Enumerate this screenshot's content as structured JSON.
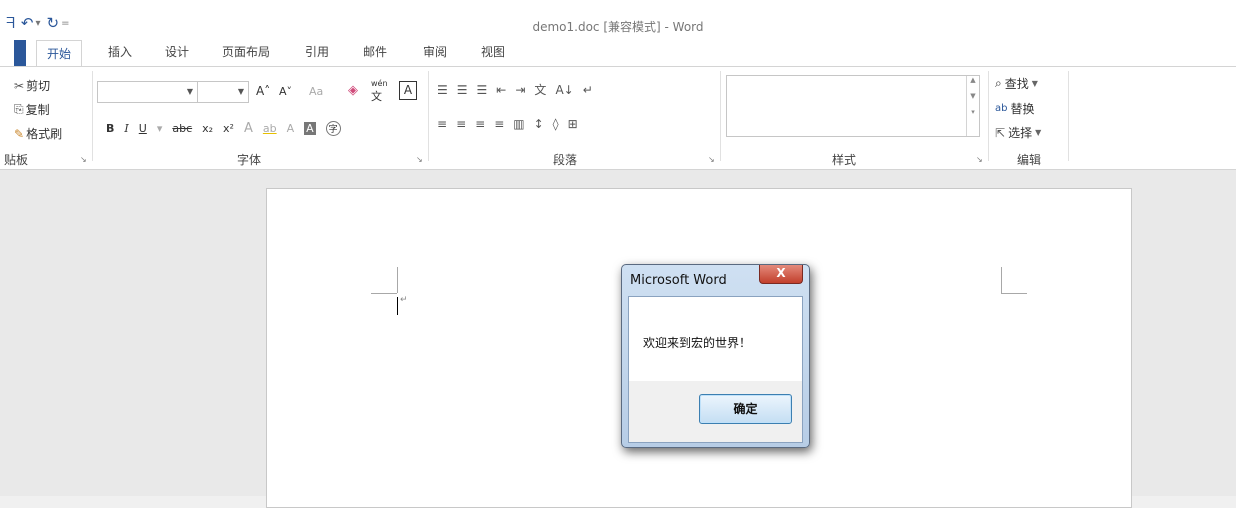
{
  "window": {
    "title": "demo1.doc [兼容模式] - Word"
  },
  "qat": {
    "save_glyph": "ᖷ",
    "undo_glyph": "↶",
    "redo_glyph": "↻",
    "dropdown_glyph": "▾",
    "customize_glyph": "="
  },
  "tabs": [
    {
      "label": "开始",
      "active": true
    },
    {
      "label": "插入"
    },
    {
      "label": "设计"
    },
    {
      "label": "页面布局"
    },
    {
      "label": "引用"
    },
    {
      "label": "邮件"
    },
    {
      "label": "审阅"
    },
    {
      "label": "视图"
    }
  ],
  "clipboard": {
    "cut": "剪切",
    "copy": "复制",
    "format_painter": "格式刷",
    "label": "贴板"
  },
  "font": {
    "label": "字体",
    "grow_glyph": "A˄",
    "shrink_glyph": "A˅",
    "case_glyph": "Aa",
    "clear_glyph": "◈",
    "pinyin_glyph": "wén",
    "pinyin_char": "文",
    "border_glyph": "A",
    "bold": "B",
    "italic": "I",
    "underline": "U",
    "strike": "abc",
    "sub": "x₂",
    "sup": "x²",
    "effects_glyph": "A",
    "highlight_glyph": "ab",
    "color_glyph": "A",
    "shade_glyph": "A",
    "enclose_glyph": "字"
  },
  "paragraph": {
    "label": "段落",
    "row1": [
      "☰",
      "☰",
      "☰",
      "⇤",
      "⇥",
      "文",
      "A↓",
      "↵"
    ],
    "row2": [
      "≡",
      "≡",
      "≡",
      "≡",
      "▥",
      "↕",
      "◊",
      "⊞"
    ]
  },
  "styles": {
    "label": "样式"
  },
  "editing": {
    "label": "编辑",
    "find": "查找",
    "replace": "替换",
    "select": "选择"
  },
  "dialog": {
    "title": "Microsoft Word",
    "close_glyph": "X",
    "message": "欢迎来到宏的世界！",
    "ok": "确定"
  },
  "colors": {
    "accent": "#2b579a",
    "close_red": "#c2402c",
    "dialog_frame": "#b7cde6"
  }
}
